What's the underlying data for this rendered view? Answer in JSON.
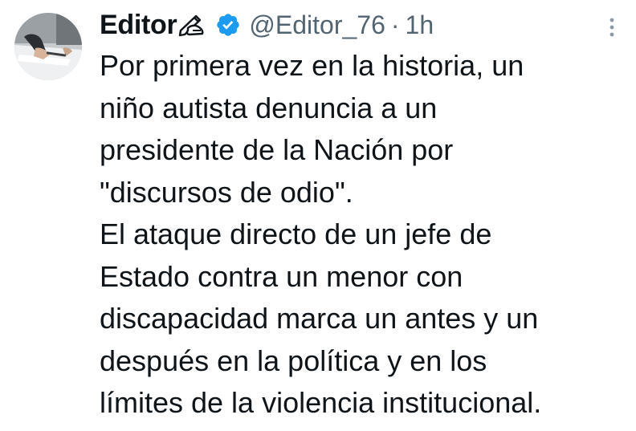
{
  "author": {
    "display_name": "Editor",
    "name_emoji": "writing-hand-icon",
    "verified_icon": "verified-badge-icon",
    "verified_color": "#1d9bf0",
    "handle": "@Editor_76",
    "separator": "·",
    "time": "1h"
  },
  "menu": {
    "icon": "more-vertical-icon"
  },
  "post": {
    "lines": [
      "Por primera vez en la historia, un",
      "niño autista denuncia a un",
      "presidente de la Nación por",
      "\"discursos de odio\".",
      "El ataque directo de un jefe de",
      "Estado contra un menor con",
      "discapacidad marca un antes y un",
      "después en la política y en los",
      "límites de la violencia institucional."
    ]
  }
}
